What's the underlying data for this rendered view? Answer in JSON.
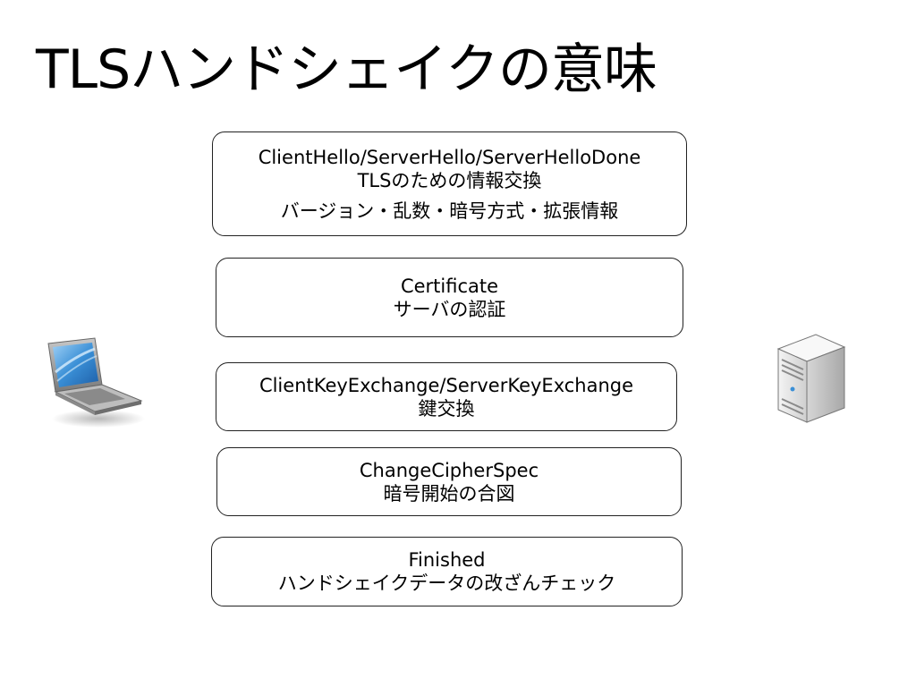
{
  "slide": {
    "title": "TLSハンドシェイクの意味"
  },
  "steps": [
    {
      "line1": "ClientHello/ServerHello/ServerHelloDone",
      "line2": "TLSのための情報交換",
      "line3": "バージョン・乱数・暗号方式・拡張情報"
    },
    {
      "line1": "Certificate",
      "line2": "サーバの認証"
    },
    {
      "line1": "ClientKeyExchange/ServerKeyExchange",
      "line2": "鍵交換"
    },
    {
      "line1": "ChangeCipherSpec",
      "line2": "暗号開始の合図"
    },
    {
      "line1": "Finished",
      "line2": "ハンドシェイクデータの改ざんチェック"
    }
  ],
  "icons": {
    "client": "laptop-icon",
    "server": "server-icon"
  },
  "colors": {
    "border": "#222222",
    "laptop_screen": "#3a8fd6",
    "laptop_body": "#8e8e8e",
    "server_body": "#e4e4e4"
  }
}
